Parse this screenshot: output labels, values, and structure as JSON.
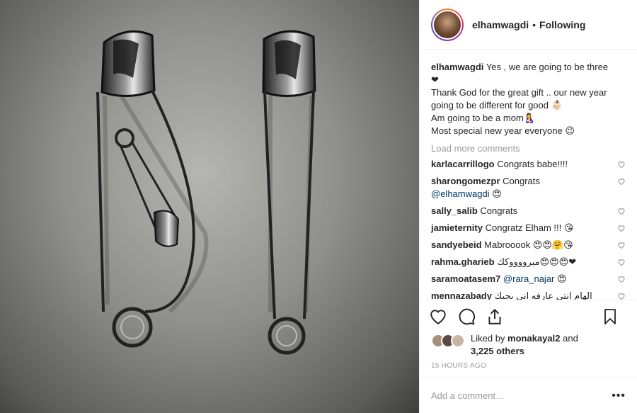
{
  "header": {
    "username": "elhamwagdi",
    "separator": "•",
    "follow_status": "Following"
  },
  "caption": {
    "username": "elhamwagdi",
    "line1": "Yes , we are going to be three",
    "line2": "❤",
    "line3": "Thank God for the great gift .. our new year going to be different for good 👶🏻",
    "line4": "Am going to be a mom🤱",
    "line5": "Most special new year everyone 😉"
  },
  "load_more": "Load more comments",
  "comments": [
    {
      "username": "karlacarrillogo",
      "text": "Congrats babe!!!!"
    },
    {
      "username": "sharongomezpr",
      "text": "Congrats",
      "mention": "@elhamwagdi",
      "after": "😍"
    },
    {
      "username": "sally_salib",
      "text": "Congrats"
    },
    {
      "username": "jamieternity",
      "text": "Congratz Elham !!! 😘"
    },
    {
      "username": "sandyebeid",
      "text": "Mabrooook 😍😍🤗😘"
    },
    {
      "username": "rahma.gharieb",
      "text": "مبرووووكك😍😍😍❤"
    },
    {
      "username": "saramoatasem7",
      "text": "",
      "mention": "@rara_najar",
      "after": "😍"
    },
    {
      "username": "mennazabady",
      "text": "الهام انتي عارفه اني بحبك"
    }
  ],
  "likes": {
    "prefix": "Liked by",
    "user": "monakayal2",
    "middle": "and",
    "count": "3,225 others"
  },
  "timestamp": "15 HOURS AGO",
  "add_comment_placeholder": "Add a comment…",
  "more_label": "•••",
  "icons": {
    "like": "heart-icon",
    "comment": "comment-icon",
    "share": "share-icon",
    "save": "bookmark-icon"
  }
}
